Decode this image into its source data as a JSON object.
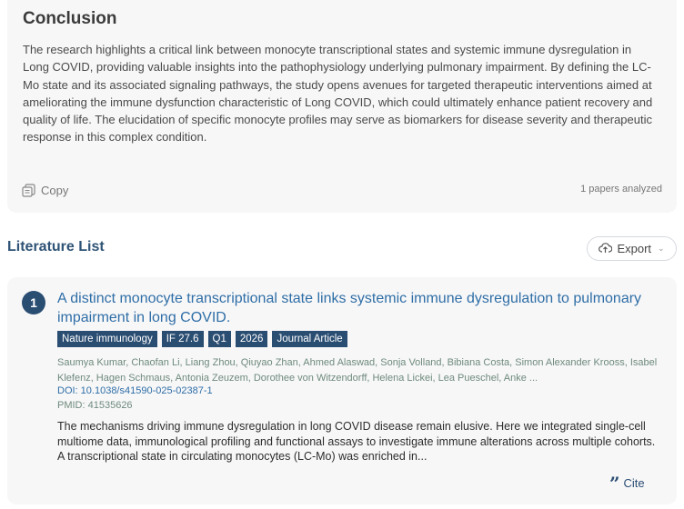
{
  "summary": {
    "title": "Conclusion",
    "text": "The research highlights a critical link between monocyte transcriptional states and systemic immune dysregulation in Long COVID, providing valuable insights into the pathophysiology underlying pulmonary impairment. By defining the LC-Mo state and its associated signaling pathways, the study opens avenues for targeted therapeutic interventions aimed at ameliorating the immune dysfunction characteristic of Long COVID, which could ultimately enhance patient recovery and quality of life. The elucidation of specific monocyte profiles may serve as biomarkers for disease severity and therapeutic response in this complex condition.",
    "copy_label": "Copy",
    "papers_count": "1 papers analyzed"
  },
  "literature": {
    "title": "Literature List",
    "export_label": "Export",
    "papers": [
      {
        "number": "1",
        "title": "A distinct monocyte transcriptional state links systemic immune dysregulation to pulmonary impairment in long COVID.",
        "tags": [
          "Nature immunology",
          "IF 27.6",
          "Q1",
          "2026",
          "Journal Article"
        ],
        "authors": "Saumya Kumar, Chaofan Li, Liang Zhou, Qiuyao Zhan, Ahmed Alaswad, Sonja Volland, Bibiana Costa, Simon Alexander Krooss, Isabel Klefenz, Hagen Schmaus, Antonia Zeuzem, Dorothee von Witzendorff, Helena Lickei, Lea Pueschel, Anke ...",
        "doi": "DOI: 10.1038/s41590-025-02387-1",
        "pmid": "PMID: 41535626",
        "abstract": "The mechanisms driving immune dysregulation in long COVID disease remain elusive. Here we integrated single-cell multiome data, immunological profiling and functional assays to investigate immune alterations across multiple cohorts. A transcriptional state in circulating monocytes (LC-Mo) was enriched in...",
        "cite_label": "Cite"
      }
    ]
  },
  "icons": {
    "copy": "copy-icon",
    "export": "cloud-upload-icon",
    "chevron": "chevron-down-icon",
    "cite": "quote-icon"
  },
  "colors": {
    "accent": "#2a4d72",
    "link": "#2f6ea6",
    "meta": "#6e8a7c",
    "card_bg": "#f7f7f8"
  }
}
